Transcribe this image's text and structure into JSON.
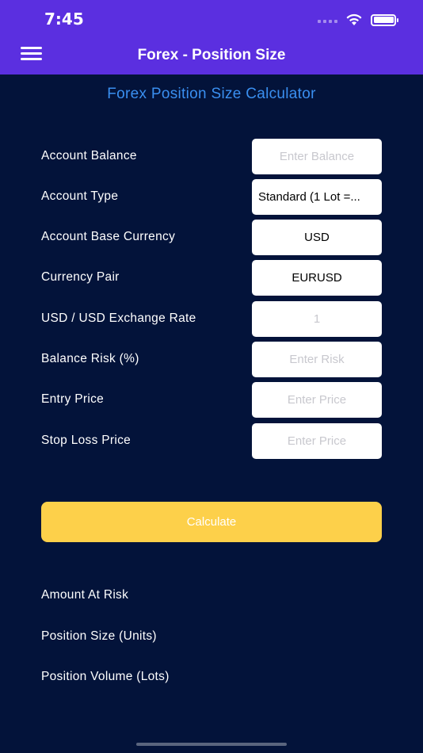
{
  "status_bar": {
    "time": "7:45"
  },
  "nav": {
    "title": "Forex - Position Size"
  },
  "calculator": {
    "title": "Forex Position Size Calculator"
  },
  "form": {
    "rows": [
      {
        "label": "Account Balance",
        "value": "",
        "placeholder": "Enter Balance"
      },
      {
        "label": "Account Type",
        "value": "Standard (1 Lot =..."
      },
      {
        "label": "Account Base Currency",
        "value": "USD"
      },
      {
        "label": "Currency Pair",
        "value": "EURUSD"
      },
      {
        "label": "USD / USD Exchange Rate",
        "value": "",
        "placeholder": "1"
      },
      {
        "label": "Balance Risk (%)",
        "value": "",
        "placeholder": "Enter Risk"
      },
      {
        "label": "Entry Price",
        "value": "",
        "placeholder": "Enter Price"
      },
      {
        "label": "Stop Loss Price",
        "value": "",
        "placeholder": "Enter Price"
      }
    ]
  },
  "actions": {
    "calculate_label": "Calculate"
  },
  "results": {
    "amount_at_risk_label": "Amount At Risk",
    "position_size_label": "Position Size (Units)",
    "position_volume_label": "Position Volume (Lots)"
  },
  "colors": {
    "nav_background": "#5b2fe0",
    "page_background": "#03133a",
    "title_accent": "#3a8ff0",
    "button": "#fdd04a"
  },
  "icons": {
    "menu": "hamburger-menu-icon",
    "signal": "cellular-signal-icon",
    "wifi": "wifi-icon",
    "battery": "battery-icon"
  }
}
